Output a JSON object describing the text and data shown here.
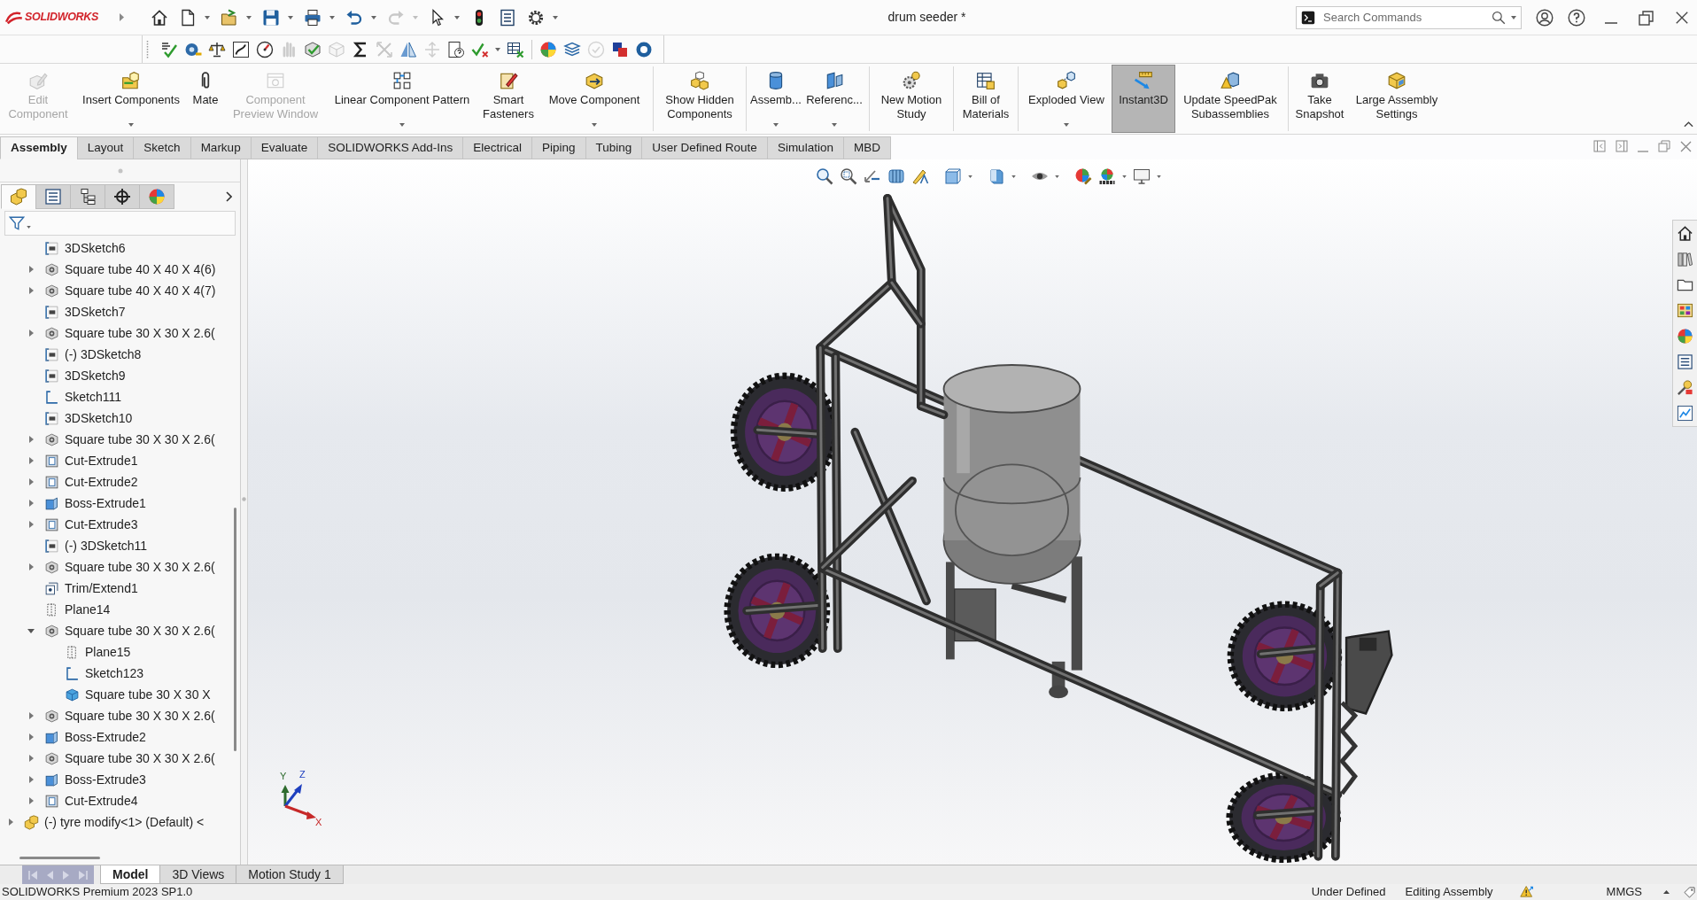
{
  "title_bar": {
    "brand": "SOLIDWORKS",
    "document_title": "drum seeder *",
    "search": {
      "placeholder": "Search Commands"
    }
  },
  "quick_access": [
    {
      "disabled": false
    },
    {
      "disabled": false
    },
    {
      "disabled": false
    },
    {
      "disabled": false
    },
    {
      "disabled": false
    },
    {
      "disabled": false
    },
    {
      "disabled": true
    },
    {
      "disabled": false
    },
    {
      "disabled": false
    },
    {
      "disabled": false
    },
    {
      "disabled": false
    }
  ],
  "tools_toolbar": {
    "groups": [
      [
        {
          "disabled": false
        },
        {
          "disabled": false
        },
        {
          "disabled": false
        },
        {
          "disabled": false
        },
        {
          "disabled": false
        },
        {
          "disabled": true
        },
        {
          "disabled": false
        },
        {
          "disabled": true
        },
        {
          "disabled": false
        },
        {
          "disabled": true
        },
        {
          "disabled": false
        },
        {
          "disabled": true
        },
        {
          "disabled": false
        },
        {
          "disabled": false
        },
        {
          "disabled": false
        }
      ],
      [
        {
          "disabled": false
        },
        {
          "disabled": false
        },
        {
          "disabled": true
        },
        {
          "disabled": false
        },
        {
          "disabled": false
        }
      ]
    ]
  },
  "command_manager": {
    "groups": [
      [
        {
          "label": "Edit Component",
          "disabled": true,
          "pressed": false,
          "dropdown": false
        },
        {
          "label": "Insert Components",
          "disabled": false,
          "pressed": false,
          "dropdown": true
        },
        {
          "label": "Mate",
          "disabled": false,
          "pressed": false,
          "dropdown": false
        },
        {
          "label": "Component Preview Window",
          "disabled": true,
          "pressed": false,
          "dropdown": false
        },
        {
          "label": "Linear Component Pattern",
          "disabled": false,
          "pressed": false,
          "dropdown": true
        },
        {
          "label": "Smart Fasteners",
          "disabled": false,
          "pressed": false,
          "dropdown": false
        },
        {
          "label": "Move Component",
          "disabled": false,
          "pressed": false,
          "dropdown": true
        }
      ],
      [
        {
          "label": "Show Hidden Components",
          "disabled": false,
          "pressed": false,
          "dropdown": false
        }
      ],
      [
        {
          "label": "Assemb...",
          "disabled": false,
          "pressed": false,
          "dropdown": true
        },
        {
          "label": "Referenc...",
          "disabled": false,
          "pressed": false,
          "dropdown": true
        }
      ],
      [
        {
          "label": "New Motion Study",
          "disabled": false,
          "pressed": false,
          "dropdown": false
        }
      ],
      [
        {
          "label": "Bill of Materials",
          "disabled": false,
          "pressed": false,
          "dropdown": false
        }
      ],
      [
        {
          "label": "Exploded View",
          "disabled": false,
          "pressed": false,
          "dropdown": true
        },
        {
          "label": "Instant3D",
          "disabled": false,
          "pressed": true,
          "dropdown": false
        },
        {
          "label": "Update SpeedPak Subassemblies",
          "disabled": false,
          "pressed": false,
          "dropdown": false
        }
      ],
      [
        {
          "label": "Take Snapshot",
          "disabled": false,
          "pressed": false,
          "dropdown": false
        },
        {
          "label": "Large Assembly Settings",
          "disabled": false,
          "pressed": false,
          "dropdown": false
        }
      ]
    ]
  },
  "tabs": [
    {
      "label": "Assembly",
      "selected": true
    },
    {
      "label": "Layout",
      "selected": false
    },
    {
      "label": "Sketch",
      "selected": false
    },
    {
      "label": "Markup",
      "selected": false
    },
    {
      "label": "Evaluate",
      "selected": false
    },
    {
      "label": "SOLIDWORKS Add-Ins",
      "selected": false
    },
    {
      "label": "Electrical",
      "selected": false
    },
    {
      "label": "Piping",
      "selected": false
    },
    {
      "label": "Tubing",
      "selected": false
    },
    {
      "label": "User Defined Route",
      "selected": false
    },
    {
      "label": "Simulation",
      "selected": false
    },
    {
      "label": "MBD",
      "selected": false
    }
  ],
  "feature_manager": {
    "panel_tabs": [
      {
        "selected": true
      },
      {
        "selected": false
      },
      {
        "selected": false
      },
      {
        "selected": false
      },
      {
        "selected": false
      }
    ],
    "tree": [
      {
        "children": [
          {
            "label": "3DSketch6",
            "kind": "sketch3d"
          },
          {
            "label": "Square tube 40 X 40 X 4(6)",
            "kind": "member",
            "expanded": false
          },
          {
            "label": "Square tube 40 X 40 X 4(7)",
            "kind": "member",
            "expanded": false
          },
          {
            "label": "3DSketch7",
            "kind": "sketch3d"
          },
          {
            "label": "Square tube 30 X 30 X 2.6(",
            "kind": "member",
            "expanded": false
          },
          {
            "label": "(-) 3DSketch8",
            "kind": "sketch3d"
          },
          {
            "label": "3DSketch9",
            "kind": "sketch3d"
          },
          {
            "label": "Sketch111",
            "kind": "sketch"
          },
          {
            "label": "3DSketch10",
            "kind": "sketch3d"
          },
          {
            "label": "Square tube 30 X 30 X 2.6(",
            "kind": "member",
            "expanded": false
          },
          {
            "label": "Cut-Extrude1",
            "kind": "cut",
            "expanded": false
          },
          {
            "label": "Cut-Extrude2",
            "kind": "cut",
            "expanded": false
          },
          {
            "label": "Boss-Extrude1",
            "kind": "boss",
            "expanded": false
          },
          {
            "label": "Cut-Extrude3",
            "kind": "cut",
            "expanded": false
          },
          {
            "label": "(-) 3DSketch11",
            "kind": "sketch3d"
          },
          {
            "label": "Square tube 30 X 30 X 2.6(",
            "kind": "member",
            "expanded": false
          },
          {
            "label": "Trim/Extend1",
            "kind": "trim"
          },
          {
            "label": "Plane14",
            "kind": "plane"
          },
          {
            "label": "Square tube 30 X 30 X 2.6(",
            "kind": "member",
            "expanded": true,
            "children": [
              {
                "label": "Plane15",
                "kind": "plane"
              },
              {
                "label": "Sketch123",
                "kind": "sketch"
              },
              {
                "label": "Square tube 30 X 30 X",
                "kind": "body"
              }
            ]
          },
          {
            "label": "Square tube 30 X 30 X 2.6(",
            "kind": "member",
            "expanded": false
          },
          {
            "label": "Boss-Extrude2",
            "kind": "boss",
            "expanded": false
          },
          {
            "label": "Square tube 30 X 30 X 2.6(",
            "kind": "member",
            "expanded": false
          },
          {
            "label": "Boss-Extrude3",
            "kind": "boss",
            "expanded": false
          },
          {
            "label": "Cut-Extrude4",
            "kind": "cut",
            "expanded": false
          }
        ]
      },
      {
        "label": "(-) tyre modify<1> (Default) <",
        "kind": "component",
        "expanded": false
      }
    ]
  },
  "viewport": {
    "triad_labels": [
      "Y",
      "Z",
      "X"
    ]
  },
  "bottom_tabs": [
    {
      "label": "Model",
      "selected": true
    },
    {
      "label": "3D Views",
      "selected": false
    },
    {
      "label": "Motion Study 1",
      "selected": false
    }
  ],
  "status_bar": {
    "product": "SOLIDWORKS Premium 2023 SP1.0",
    "definition": "Under Defined",
    "mode": "Editing Assembly",
    "units": "MMGS"
  }
}
